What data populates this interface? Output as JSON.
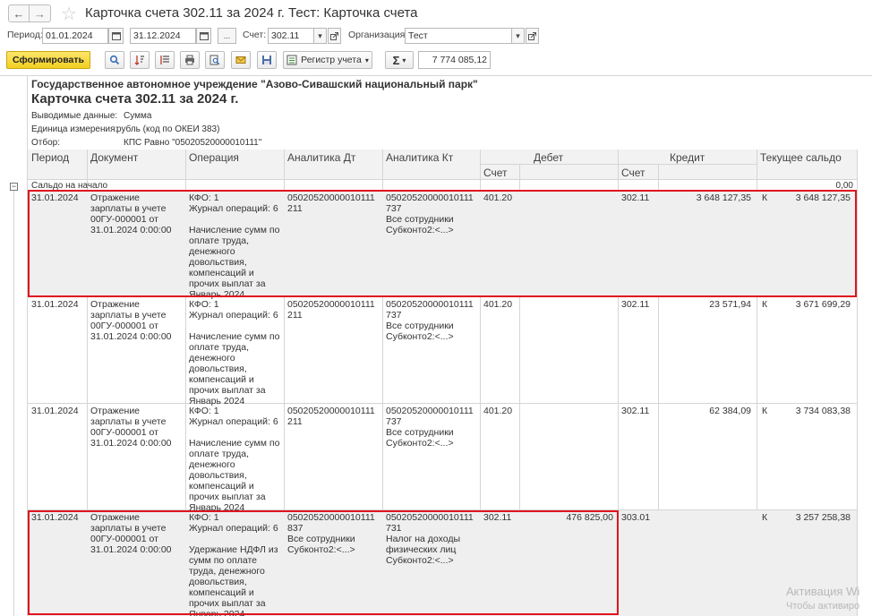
{
  "window": {
    "title": "Карточка счета 302.11 за 2024 г. Тест: Карточка счета",
    "back_icon": "arrow-left",
    "forward_icon": "arrow-right",
    "favorite_icon": "star"
  },
  "filters": {
    "period_label": "Период:",
    "date_from": "01.01.2024",
    "date_to": "31.12.2024",
    "more_label": "...",
    "account_label": "Счет:",
    "account_value": "302.11",
    "org_label": "Организация:",
    "org_value": "Тест"
  },
  "toolbar": {
    "generate_label": "Сформировать",
    "register_label": "Регистр учета",
    "sum_label": "Σ",
    "sum_value": "7 774 085,12"
  },
  "report": {
    "org_title": "Государственное автономное учреждение \"Азово-Сивашский национальный парк\"",
    "title": "Карточка счета 302.11 за 2024 г.",
    "output_label": "Выводимые данные:",
    "output_value": "Сумма",
    "unit_label": "Единица измерения:",
    "unit_value": "рубль (код по ОКЕИ 383)",
    "filter_label": "Отбор:",
    "filter_value": "КПС Равно \"05020520000010111\"",
    "opening_label": "Сальдо на начало",
    "opening_value": "0,00",
    "columns": {
      "period": "Период",
      "document": "Документ",
      "operation": "Операция",
      "analytics_dt": "Аналитика Дт",
      "analytics_kt": "Аналитика Кт",
      "debit": "Дебет",
      "credit": "Кредит",
      "balance": "Текущее сальдо",
      "account": "Счет"
    },
    "rows": [
      {
        "date": "31.01.2024",
        "document": "Отражение зарплаты в учете 00ГУ-000001 от 31.01.2024 0:00:00",
        "operation": "КФО: 1\nЖурнал операций: 6\n\nНачисление сумм по оплате труда, денежного довольствия, компенсаций и прочих выплат за Январь 2024",
        "analytics_dt": "05020520000010111\n211",
        "analytics_kt": "05020520000010111\n737\nВсе сотрудники\nСубконто2:<...>",
        "debit_account": "401.20",
        "debit_amount": "",
        "credit_account": "302.11",
        "credit_amount": "3 648 127,35",
        "balance_side": "К",
        "balance": "3 648 127,35"
      },
      {
        "date": "31.01.2024",
        "document": "Отражение зарплаты в учете 00ГУ-000001 от 31.01.2024 0:00:00",
        "operation": "КФО: 1\nЖурнал операций: 6\n\nНачисление сумм по оплате труда, денежного довольствия, компенсаций и прочих выплат за Январь 2024",
        "analytics_dt": "05020520000010111\n211",
        "analytics_kt": "05020520000010111\n737\nВсе сотрудники\nСубконто2:<...>",
        "debit_account": "401.20",
        "debit_amount": "",
        "credit_account": "302.11",
        "credit_amount": "23 571,94",
        "balance_side": "К",
        "balance": "3 671 699,29"
      },
      {
        "date": "31.01.2024",
        "document": "Отражение зарплаты в учете 00ГУ-000001 от 31.01.2024 0:00:00",
        "operation": "КФО: 1\nЖурнал операций: 6\n\nНачисление сумм по оплате труда, денежного довольствия, компенсаций и прочих выплат за Январь 2024",
        "analytics_dt": "05020520000010111\n211",
        "analytics_kt": "05020520000010111\n737\nВсе сотрудники\nСубконто2:<...>",
        "debit_account": "401.20",
        "debit_amount": "",
        "credit_account": "302.11",
        "credit_amount": "62 384,09",
        "balance_side": "К",
        "balance": "3 734 083,38"
      },
      {
        "date": "31.01.2024",
        "document": "Отражение зарплаты в учете 00ГУ-000001 от 31.01.2024 0:00:00",
        "operation": "КФО: 1\nЖурнал операций: 6\n\nУдержание НДФЛ из сумм по оплате труда, денежного довольствия, компенсаций и прочих выплат за Январь 2024",
        "analytics_dt": "05020520000010111\n837\nВсе сотрудники\nСубконто2:<...>",
        "analytics_kt": "05020520000010111\n731\nНалог на доходы физических лиц\nСубконто2:<...>",
        "debit_account": "302.11",
        "debit_amount": "476 825,00",
        "credit_account": "303.01",
        "credit_amount": "",
        "balance_side": "К",
        "balance": "3 257 258,38"
      }
    ]
  },
  "watermark": {
    "line1": "Активация Wi",
    "line2": "Чтобы активиро"
  },
  "colors": {
    "highlight": "#e0141e",
    "primary_button": "#f2cf22",
    "header_bg": "#f2f2f2",
    "selected_row_bg": "#f0f0f0"
  }
}
